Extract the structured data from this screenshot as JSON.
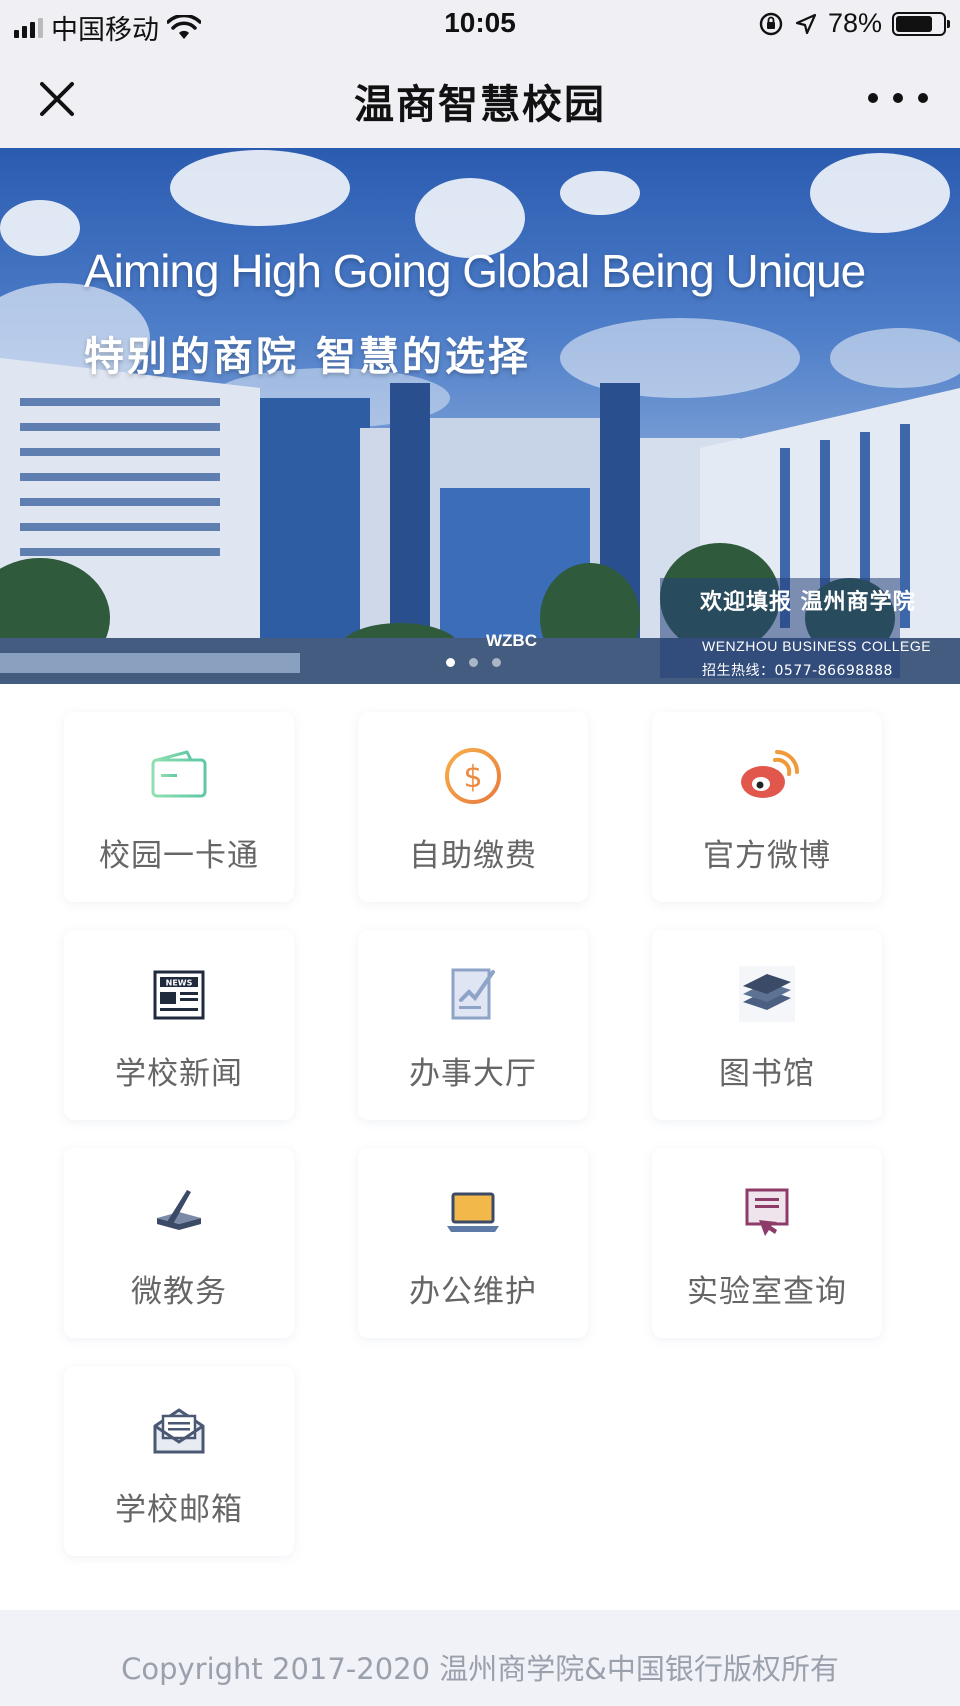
{
  "status_bar": {
    "carrier": "中国移动",
    "time": "10:05",
    "battery_percent": "78%",
    "battery_level": 0.78,
    "icons": [
      "signal-icon",
      "wifi-icon",
      "orientation-lock-icon",
      "location-icon",
      "battery-icon"
    ]
  },
  "nav": {
    "title": "温商智慧校园",
    "close_icon": "close-icon",
    "more_icon": "more-icon"
  },
  "banner": {
    "slogan": "Aiming High Going Global Being Unique",
    "tagline": "特别的商院 智慧的选择",
    "welcome": "欢迎填报 温州商学院",
    "college_en": "WENZHOU BUSINESS COLLEGE",
    "hotline": "招生热线：0577-86698888",
    "sign": "WZBC",
    "slide_count": 3,
    "active_slide": 1
  },
  "tiles": [
    {
      "label": "校园一卡通",
      "icon": "campus-card-icon"
    },
    {
      "label": "自助缴费",
      "icon": "payment-icon"
    },
    {
      "label": "官方微博",
      "icon": "weibo-icon"
    },
    {
      "label": "学校新闻",
      "icon": "news-icon"
    },
    {
      "label": "办事大厅",
      "icon": "service-hall-icon"
    },
    {
      "label": "图书馆",
      "icon": "library-icon"
    },
    {
      "label": "微教务",
      "icon": "academic-affairs-icon"
    },
    {
      "label": "办公维护",
      "icon": "office-maintenance-icon"
    },
    {
      "label": "实验室查询",
      "icon": "lab-query-icon"
    },
    {
      "label": "学校邮箱",
      "icon": "school-mail-icon"
    }
  ],
  "colors": {
    "bar_bg": "#efeff4",
    "card_green": "#7fd3a8",
    "pay_orange": "#f0a046",
    "weibo_red": "#e2574c",
    "icon_navy": "#3b4a66",
    "lab_purple": "#8d3c6a",
    "footer_bg": "#f1f2f7",
    "footer_text": "#9aa0ac"
  },
  "footer": {
    "copyright": "Copyright 2017-2020 温州商学院&中国银行版权所有"
  }
}
